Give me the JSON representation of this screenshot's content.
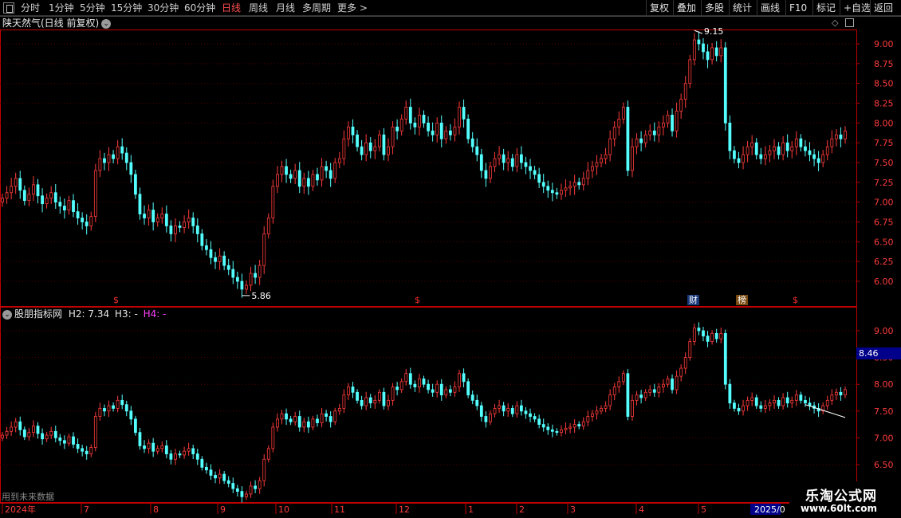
{
  "toolbar": {
    "periods": [
      "分时",
      "1分钟",
      "5分钟",
      "15分钟",
      "30分钟",
      "60分钟",
      "日线",
      "周线",
      "月线",
      "多周期",
      "更多"
    ],
    "active_period": "日线",
    "tools": [
      "复权",
      "叠加",
      "多股",
      "统计",
      "画线",
      "F10",
      "标记",
      "+自选",
      "返回"
    ]
  },
  "main_pane": {
    "title": "陕天然气(日线 前复权)",
    "high_label": "9.15",
    "low_label": "5.86",
    "markers": [
      {
        "text": "$",
        "color": "#ff3030"
      },
      {
        "text": "$",
        "color": "#ff3030"
      },
      {
        "text": "财",
        "color": "#60a0ff"
      },
      {
        "text": "榜",
        "color": "#ffa040"
      },
      {
        "text": "$",
        "color": "#ff3030"
      }
    ]
  },
  "indicator_pane": {
    "name": "股朋指标网",
    "h2_label": "H2:",
    "h2_value": "7.34",
    "h3_label": "H3:",
    "h3_value": "-",
    "h4_label": "H4:",
    "h4_value": "-",
    "price_tag": "8.46",
    "footnote": "用到未来数据"
  },
  "x_axis": {
    "labels": [
      "2024年",
      "7",
      "8",
      "9",
      "10",
      "11",
      "12",
      "1",
      "2",
      "3",
      "4",
      "5",
      "2025/0"
    ]
  },
  "watermark": {
    "line1": "乐淘公式网",
    "line2": "www.60lt.com"
  },
  "colors": {
    "up": "#ff3c3c",
    "down": "#54ffff",
    "axis": "#c00000",
    "grid": "#5a0000",
    "active": "#ff5050",
    "h4": "#ff40ff"
  },
  "chart_data": {
    "type": "candlestick",
    "price_axis_main": [
      "9.00",
      "8.75",
      "8.50",
      "8.25",
      "8.00",
      "7.75",
      "7.50",
      "7.25",
      "7.00",
      "6.75",
      "6.50",
      "6.25",
      "6.00"
    ],
    "price_axis_indicator": [
      "9.00",
      "8.50",
      "8.00",
      "7.50",
      "7.00",
      "6.50"
    ],
    "closes": [
      7.05,
      7.12,
      7.2,
      7.3,
      7.15,
      7.02,
      7.1,
      7.22,
      7.08,
      6.98,
      7.05,
      7.12,
      7.0,
      6.95,
      6.9,
      7.02,
      6.88,
      6.8,
      6.75,
      6.7,
      6.82,
      7.4,
      7.55,
      7.5,
      7.6,
      7.55,
      7.7,
      7.62,
      7.5,
      7.35,
      7.1,
      6.85,
      6.8,
      6.9,
      6.75,
      6.8,
      6.85,
      6.7,
      6.6,
      6.7,
      6.68,
      6.75,
      6.8,
      6.7,
      6.6,
      6.45,
      6.4,
      6.3,
      6.25,
      6.32,
      6.2,
      6.15,
      6.05,
      6.0,
      5.9,
      5.95,
      6.1,
      6.05,
      6.2,
      6.6,
      6.8,
      7.2,
      7.35,
      7.45,
      7.35,
      7.3,
      7.4,
      7.2,
      7.3,
      7.2,
      7.35,
      7.28,
      7.45,
      7.4,
      7.3,
      7.5,
      7.55,
      7.8,
      7.95,
      7.85,
      7.7,
      7.6,
      7.75,
      7.65,
      7.7,
      7.85,
      7.6,
      7.7,
      7.95,
      7.9,
      8.05,
      8.2,
      8.0,
      7.95,
      8.1,
      8.0,
      7.9,
      7.85,
      8.0,
      7.8,
      7.9,
      7.85,
      7.95,
      8.2,
      8.05,
      7.8,
      7.7,
      7.6,
      7.4,
      7.3,
      7.45,
      7.55,
      7.6,
      7.5,
      7.55,
      7.45,
      7.6,
      7.5,
      7.45,
      7.4,
      7.35,
      7.25,
      7.2,
      7.15,
      7.12,
      7.1,
      7.15,
      7.18,
      7.2,
      7.25,
      7.22,
      7.3,
      7.4,
      7.45,
      7.5,
      7.55,
      7.6,
      7.8,
      7.95,
      8.05,
      8.2,
      7.4,
      7.7,
      7.8,
      7.75,
      7.85,
      7.9,
      7.85,
      7.95,
      8.0,
      8.1,
      7.9,
      8.15,
      8.3,
      8.5,
      8.8,
      9.05,
      9.0,
      8.9,
      8.8,
      8.95,
      8.85,
      8.95,
      8.0,
      7.65,
      7.55,
      7.5,
      7.6,
      7.7,
      7.75,
      7.6,
      7.55,
      7.6,
      7.65,
      7.7,
      7.6,
      7.75,
      7.65,
      7.7,
      7.8,
      7.7,
      7.65,
      7.6,
      7.55,
      7.5,
      7.6,
      7.7,
      7.8,
      7.85,
      7.8,
      7.9
    ]
  }
}
